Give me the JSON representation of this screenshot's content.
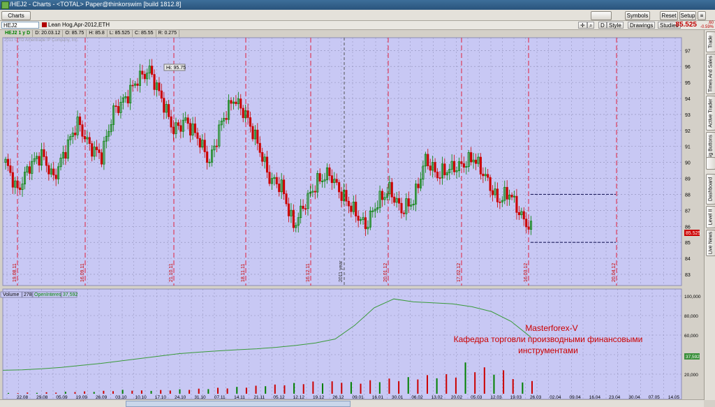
{
  "window": {
    "title": "/HEJ2 - Charts - <TOTAL> Paper@thinkorswim [build 1812.8]"
  },
  "menubar": {
    "charts_label": "Charts",
    "symbols_label": "Symbols",
    "reset_label": "Reset",
    "setup_label": "Setup"
  },
  "toolbar": {
    "symbol": "HEJ2",
    "description": "Lean Hog,Apr-2012,ETH",
    "d_label": "D",
    "style_label": "Style",
    "drawings_label": "Drawings",
    "studies_label": "Studies",
    "last_price": "85.525",
    "change_top": ".60",
    "change_bottom": "-0.59%"
  },
  "info": {
    "symbol_period": "HEJ2 1 y D",
    "date": "D: 20.03.12",
    "open": "O: 85.75",
    "high": "H: 85.8",
    "low": "L: 85.525",
    "close": "C: 85.55",
    "range": "R: 0.275"
  },
  "copyright": "2011 © TD Ameritrade IP Company, Inc.",
  "sidebar": {
    "tabs": [
      "Trade",
      "Times And Sales",
      "Active Trader",
      "Big Buttons",
      "",
      "Dashboard",
      "Level II",
      "Live News"
    ]
  },
  "colors": {
    "background": "#c8c8f4",
    "up": "#008000",
    "down": "#cc0000",
    "grid": "#8c8cb4",
    "price_tag": "#cc0000"
  },
  "watermark": {
    "line1": "Masterforex-V",
    "line2": "Кафедра торговли производными финансовыми",
    "line3": "инструментами"
  },
  "chart_data": [
    {
      "type": "candlestick",
      "title": "HEJ2 1 y D",
      "yticks": [
        "97",
        "96",
        "95",
        "94",
        "93",
        "92",
        "91",
        "90",
        "89",
        "88",
        "87",
        "86",
        "85",
        "84",
        "83"
      ],
      "ylim": [
        82.3,
        97.8
      ],
      "last_price_tag": "85.525",
      "high_label": "Hi: 95.75",
      "year_marker": "2011 year",
      "expiration_markers": [
        "19.08.11",
        "16.09.11",
        "21.10.11",
        "18.11.11",
        "16.12.11",
        "20.01.12",
        "17.02.12",
        "16.03.12",
        "20.04.12"
      ],
      "levels": [
        88.0,
        85.0
      ],
      "close_points": [
        90.0,
        88.2,
        89.8,
        90.5,
        89.0,
        90.8,
        92.5,
        91.0,
        90.4,
        93.2,
        94.0,
        95.2,
        95.75,
        94.0,
        92.0,
        92.6,
        91.6,
        90.0,
        92.5,
        94.0,
        93.0,
        91.2,
        89.0,
        88.5,
        86.0,
        87.5,
        88.8,
        89.3,
        88.0,
        87.0,
        86.0,
        87.5,
        88.3,
        87.0,
        87.6,
        90.2,
        89.2,
        89.6,
        89.8,
        90.3,
        89.1,
        87.6,
        88.1,
        86.6,
        85.6
      ],
      "grid": true
    },
    {
      "type": "bar",
      "title": "Volume",
      "series": [
        {
          "name": "Volume",
          "values": [
            278
          ]
        },
        {
          "name": "OpenInterest",
          "values": [
            37592
          ]
        }
      ],
      "legend": [
        "Volume",
        "278",
        "OpenInterest",
        "37,592"
      ],
      "yticks": [
        "100,000",
        "80,000",
        "60,000",
        "40,000",
        "20,000"
      ],
      "ylim": [
        0,
        100000
      ],
      "oi_tag": "37,592",
      "x_ticks": [
        "22.08",
        "29.08",
        "05.09",
        "19.09",
        "26.09",
        "03.10",
        "10.10",
        "17.10",
        "24.10",
        "31.10",
        "07.11",
        "14.11",
        "21.11",
        "05.12",
        "12.12",
        "19.12",
        "26.12",
        "09.01",
        "16.01",
        "30.01",
        "06.02",
        "13.02",
        "20.02",
        "05.03",
        "12.03",
        "19.03",
        "26.03",
        "02.04",
        "09.04",
        "16.04",
        "23.04",
        "30.04",
        "07.05",
        "14.05"
      ],
      "oi_curve": [
        24000,
        24500,
        25500,
        27000,
        29000,
        31000,
        33500,
        36000,
        38500,
        41000,
        42500,
        43800,
        45000,
        46000,
        47500,
        49500,
        52000,
        56000,
        70000,
        88000,
        97000,
        94000,
        93000,
        92000,
        89000,
        84000,
        74000,
        58000
      ],
      "volume_bars": [
        800,
        600,
        1200,
        900,
        1500,
        1100,
        2000,
        1700,
        2400,
        1800,
        3000,
        2600,
        4000,
        3100,
        3400,
        2900,
        3800,
        3300,
        4500,
        3900,
        5200,
        4700,
        6100,
        5400,
        7000,
        6200,
        8200,
        7700,
        9400,
        8600,
        11000,
        9800,
        12500,
        10600,
        12700,
        11200,
        12000,
        10300,
        13800,
        11800,
        15500,
        12800,
        17000,
        14600,
        19000,
        15800,
        20000,
        16500,
        32000,
        22000,
        27000,
        19500,
        24000,
        15000,
        11500,
        13000
      ]
    }
  ]
}
